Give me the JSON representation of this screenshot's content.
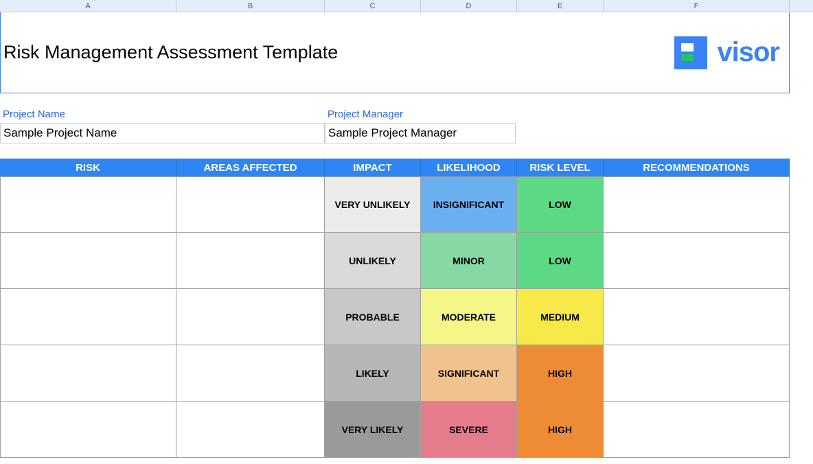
{
  "column_headers": [
    "A",
    "B",
    "C",
    "D",
    "E",
    "F"
  ],
  "title": "Risk Management Assessment Template",
  "brand_name": "visor",
  "labels": {
    "project_name": "Project Name",
    "project_manager": "Project Manager"
  },
  "values": {
    "project_name": "Sample Project Name",
    "project_manager": "Sample Project Manager"
  },
  "table_headers": [
    "RISK",
    "AREAS AFFECTED",
    "IMPACT",
    "LIKELIHOOD",
    "RISK LEVEL",
    "RECOMMENDATIONS"
  ],
  "rows": [
    {
      "impact": "VERY UNLIKELY",
      "likelihood": "INSIGNIFICANT",
      "risk_level": "LOW",
      "impact_class": "c-ltgrey",
      "likelihood_class": "c-blue",
      "risk_class": "c-green"
    },
    {
      "impact": "UNLIKELY",
      "likelihood": "MINOR",
      "risk_level": "LOW",
      "impact_class": "c-grey1",
      "likelihood_class": "c-mint",
      "risk_class": "c-green"
    },
    {
      "impact": "PROBABLE",
      "likelihood": "MODERATE",
      "risk_level": "MEDIUM",
      "impact_class": "c-grey2",
      "likelihood_class": "c-yellow",
      "risk_class": "c-yellowd"
    },
    {
      "impact": "LIKELY",
      "likelihood": "SIGNIFICANT",
      "risk_level": "HIGH",
      "impact_class": "c-grey3",
      "likelihood_class": "c-peach",
      "risk_class": "c-orange"
    },
    {
      "impact": "VERY LIKELY",
      "likelihood": "SEVERE",
      "risk_level": "HIGH",
      "impact_class": "c-grey4",
      "likelihood_class": "c-pink",
      "risk_class": "c-orange"
    }
  ]
}
